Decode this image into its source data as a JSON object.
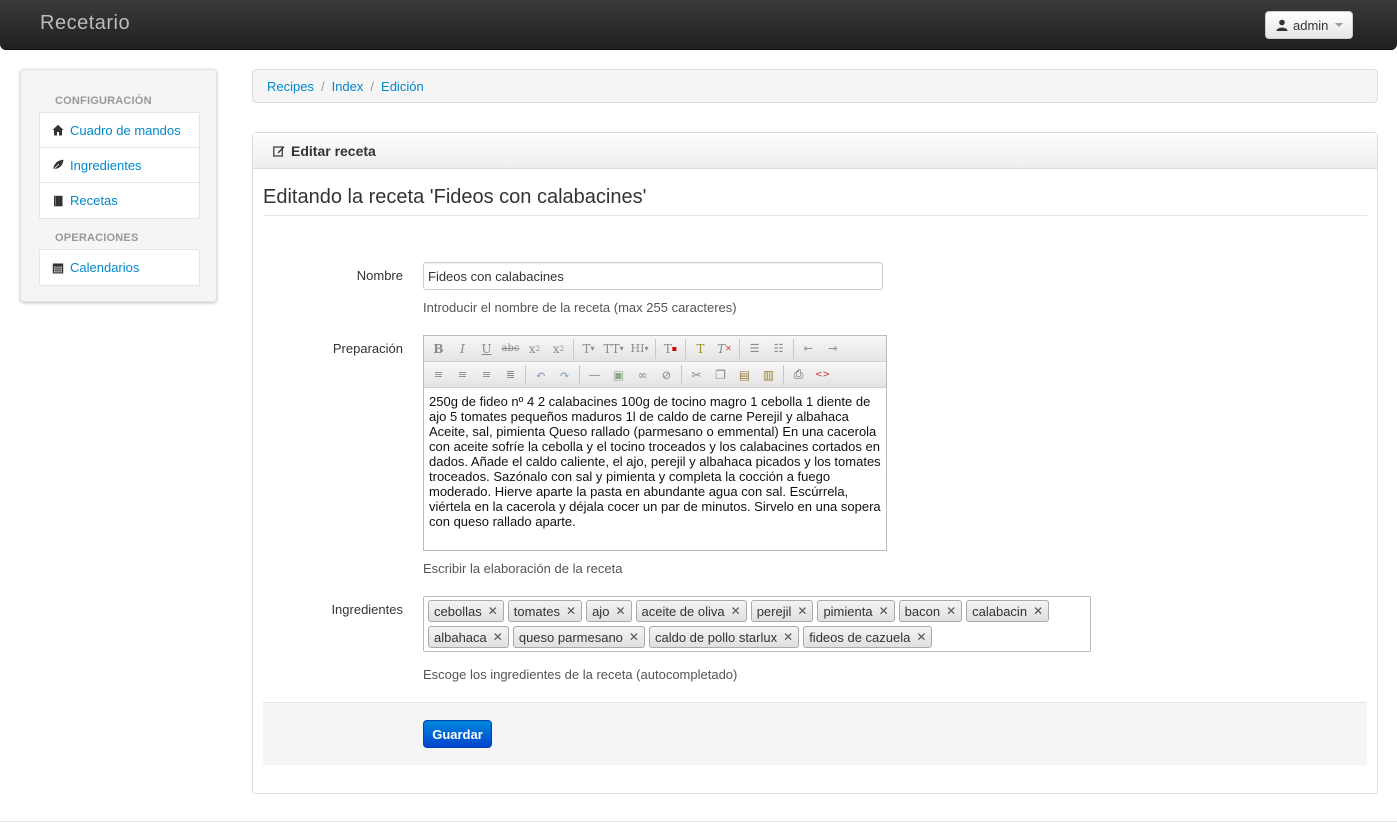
{
  "navbar": {
    "brand": "Recetario",
    "user_label": "admin"
  },
  "sidebar": {
    "sections": [
      {
        "header": "CONFIGURACIÓN",
        "items": [
          {
            "label": "Cuadro de mandos",
            "icon": "home-icon"
          },
          {
            "label": "Ingredientes",
            "icon": "leaf-icon"
          },
          {
            "label": "Recetas",
            "icon": "book-icon"
          }
        ]
      },
      {
        "header": "OPERACIONES",
        "items": [
          {
            "label": "Calendarios",
            "icon": "calendar-icon"
          }
        ]
      }
    ]
  },
  "breadcrumb": [
    "Recipes",
    "Index",
    "Edición"
  ],
  "panel": {
    "heading": "Editar receta",
    "page_title": "Editando la receta 'Fideos con calabacines'"
  },
  "form": {
    "name": {
      "label": "Nombre",
      "value": "Fideos con calabacines",
      "help": "Introducir el nombre de la receta (max 255 caracteres)"
    },
    "preparation": {
      "label": "Preparación",
      "value": "250g de fideo nº 4 2 calabacines 100g de tocino magro 1 cebolla 1 diente de ajo 5 tomates pequeños maduros 1l de caldo de carne Perejil y albahaca Aceite, sal, pimienta Queso rallado (parmesano o emmental) En una cacerola con aceite sofríe la cebolla y el tocino troceados y los calabacines cortados en dados. Añade el caldo caliente, el ajo, perejil y albahaca picados y los tomates troceados. Sazónalo con sal y pimienta y completa la cocción a fuego moderado. Hierve aparte la pasta en abundante agua con sal. Escúrrela, viértela en la cacerola y déjala cocer un par de minutos. Sirvelo en una sopera con queso rallado aparte.",
      "help": "Escribir la elaboración de la receta"
    },
    "ingredients": {
      "label": "Ingredientes",
      "tags": [
        "cebollas",
        "tomates",
        "ajo",
        "aceite de oliva",
        "perejil",
        "pimienta",
        "bacon",
        "calabacin",
        "albahaca",
        "queso parmesano",
        "caldo de pollo starlux",
        "fideos de cazuela"
      ],
      "help": "Escoge los ingredientes de la receta (autocompletado)"
    },
    "save_label": "Guardar"
  },
  "colors": {
    "link": "#0088cc",
    "primary_button": "#0055cc",
    "navbar": "#2a2a2a"
  }
}
